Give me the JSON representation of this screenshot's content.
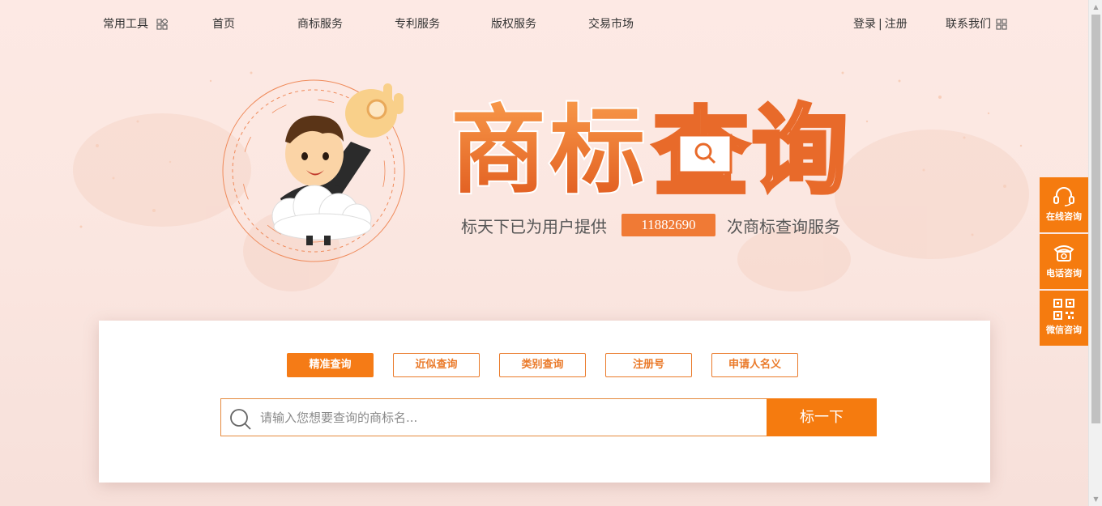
{
  "nav": {
    "tools": "常用工具",
    "home": "首页",
    "trademark": "商标服务",
    "patent": "专利服务",
    "copyright": "版权服务",
    "market": "交易市场",
    "login": "登录",
    "separator": "|",
    "register": "注册",
    "contact": "联系我们"
  },
  "hero": {
    "title_chars": [
      "商",
      "标",
      "查",
      "询"
    ],
    "tagline_prefix": "标天下已为用户提供",
    "count": "11882690",
    "tagline_suffix": "次商标查询服务"
  },
  "search": {
    "tabs": [
      {
        "label": "精准查询",
        "active": true
      },
      {
        "label": "近似查询",
        "active": false
      },
      {
        "label": "类别查询",
        "active": false
      },
      {
        "label": "注册号",
        "active": false
      },
      {
        "label": "申请人名义",
        "active": false
      }
    ],
    "placeholder": "请输入您想要查询的商标名...",
    "button": "标一下"
  },
  "sidebar": {
    "items": [
      {
        "label": "在线咨询",
        "icon": "headset-icon"
      },
      {
        "label": "电话咨询",
        "icon": "phone-icon"
      },
      {
        "label": "微信咨询",
        "icon": "qrcode-icon"
      }
    ]
  },
  "colors": {
    "accent": "#f57b0f",
    "tab_border": "#ea7a2a",
    "background": "#fbe7e1"
  }
}
